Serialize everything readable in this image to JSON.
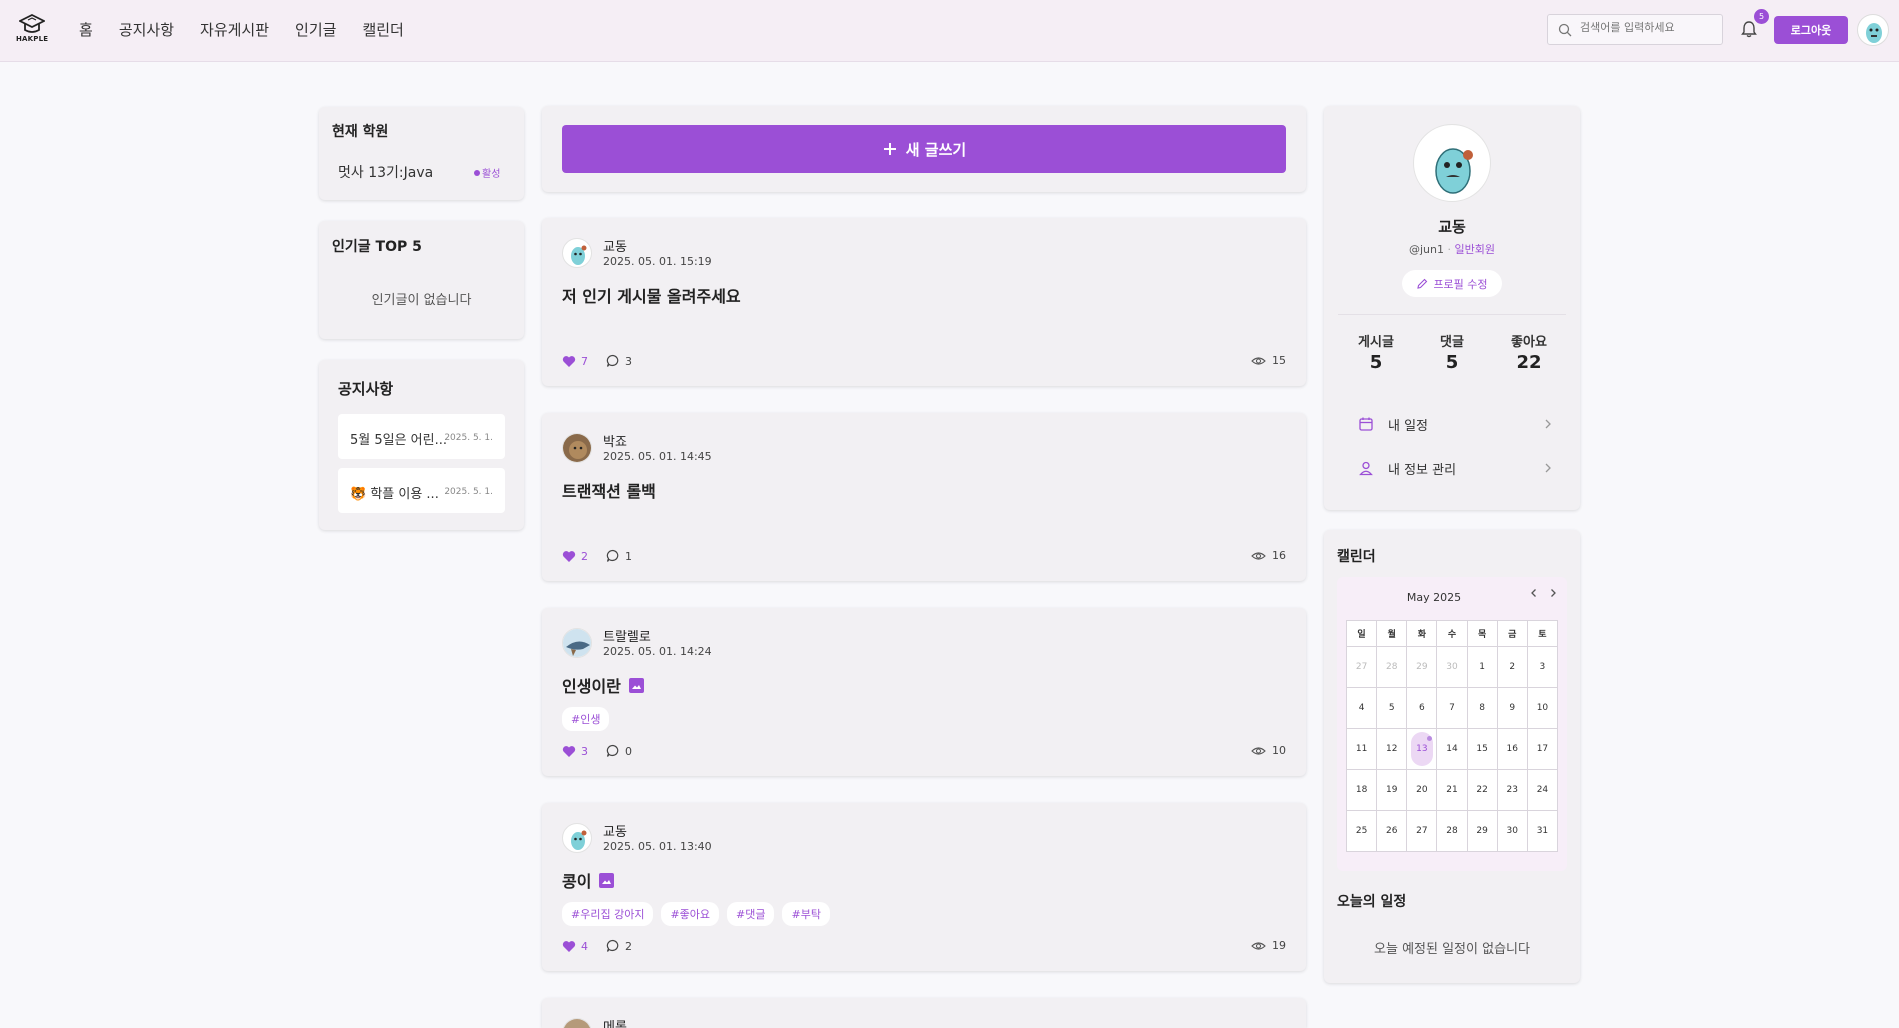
{
  "brand": {
    "logo_text": "HAKPLE"
  },
  "nav": [
    "홈",
    "공지사항",
    "자유게시판",
    "인기글",
    "캘린더"
  ],
  "search": {
    "placeholder": "검색어를 입력하세요"
  },
  "notifications": {
    "count": "5"
  },
  "header": {
    "logout_label": "로그아웃"
  },
  "academy": {
    "title": "현재 학원",
    "name": "멋사 13기:Java",
    "status": "활성"
  },
  "top5": {
    "title": "인기글 TOP 5",
    "empty": "인기글이 없습니다"
  },
  "notices": {
    "title": "공지사항",
    "items": [
      {
        "title": "5월 5일은 어린...",
        "date": "2025. 5. 1."
      },
      {
        "title": "🐯 학플 이용 ...",
        "date": "2025. 5. 1."
      }
    ]
  },
  "write": {
    "label": "새 글쓰기"
  },
  "posts": [
    {
      "author": "교동",
      "date": "2025. 05. 01. 15:19",
      "title": "저 인기 게시물 올려주세요",
      "has_image": false,
      "tags": [],
      "likes": "7",
      "comments": "3",
      "views": "15"
    },
    {
      "author": "박죠",
      "date": "2025. 05. 01. 14:45",
      "title": "트랜잭션 롤백",
      "has_image": false,
      "tags": [],
      "likes": "2",
      "comments": "1",
      "views": "16"
    },
    {
      "author": "트랄렐로",
      "date": "2025. 05. 01. 14:24",
      "title": "인생이란",
      "has_image": true,
      "tags": [
        "#인생"
      ],
      "likes": "3",
      "comments": "0",
      "views": "10"
    },
    {
      "author": "교동",
      "date": "2025. 05. 01. 13:40",
      "title": "콩이",
      "has_image": true,
      "tags": [
        "#우리집 강아지",
        "#좋아요",
        "#댓글",
        "#부탁"
      ],
      "likes": "4",
      "comments": "2",
      "views": "19"
    },
    {
      "author": "메롱",
      "date": "",
      "title": "",
      "has_image": false,
      "tags": [],
      "likes": "",
      "comments": "",
      "views": ""
    }
  ],
  "profile": {
    "name": "교동",
    "handle": "@jun1",
    "role": "일반회원",
    "edit_label": "프로필 수정",
    "stats": [
      {
        "label": "게시글",
        "value": "5"
      },
      {
        "label": "댓글",
        "value": "5"
      },
      {
        "label": "좋아요",
        "value": "22"
      }
    ],
    "links": [
      {
        "label": "내 일정",
        "icon": "calendar-icon"
      },
      {
        "label": "내 정보 관리",
        "icon": "user-icon"
      }
    ]
  },
  "calendar": {
    "title": "캘린더",
    "month": "May 2025",
    "weekdays": [
      "일",
      "월",
      "화",
      "수",
      "목",
      "금",
      "토"
    ],
    "weeks": [
      [
        "27",
        "28",
        "29",
        "30",
        "1",
        "2",
        "3"
      ],
      [
        "4",
        "5",
        "6",
        "7",
        "8",
        "9",
        "10"
      ],
      [
        "11",
        "12",
        "13",
        "14",
        "15",
        "16",
        "17"
      ],
      [
        "18",
        "19",
        "20",
        "21",
        "22",
        "23",
        "24"
      ],
      [
        "25",
        "26",
        "27",
        "28",
        "29",
        "30",
        "31"
      ]
    ],
    "today": "13",
    "today_title": "오늘의 일정",
    "today_empty": "오늘 예정된 일정이 없습니다"
  },
  "colors": {
    "accent": "#9b4fd6",
    "header_bg": "#f5eef5",
    "page_bg": "#f8f8fb"
  }
}
